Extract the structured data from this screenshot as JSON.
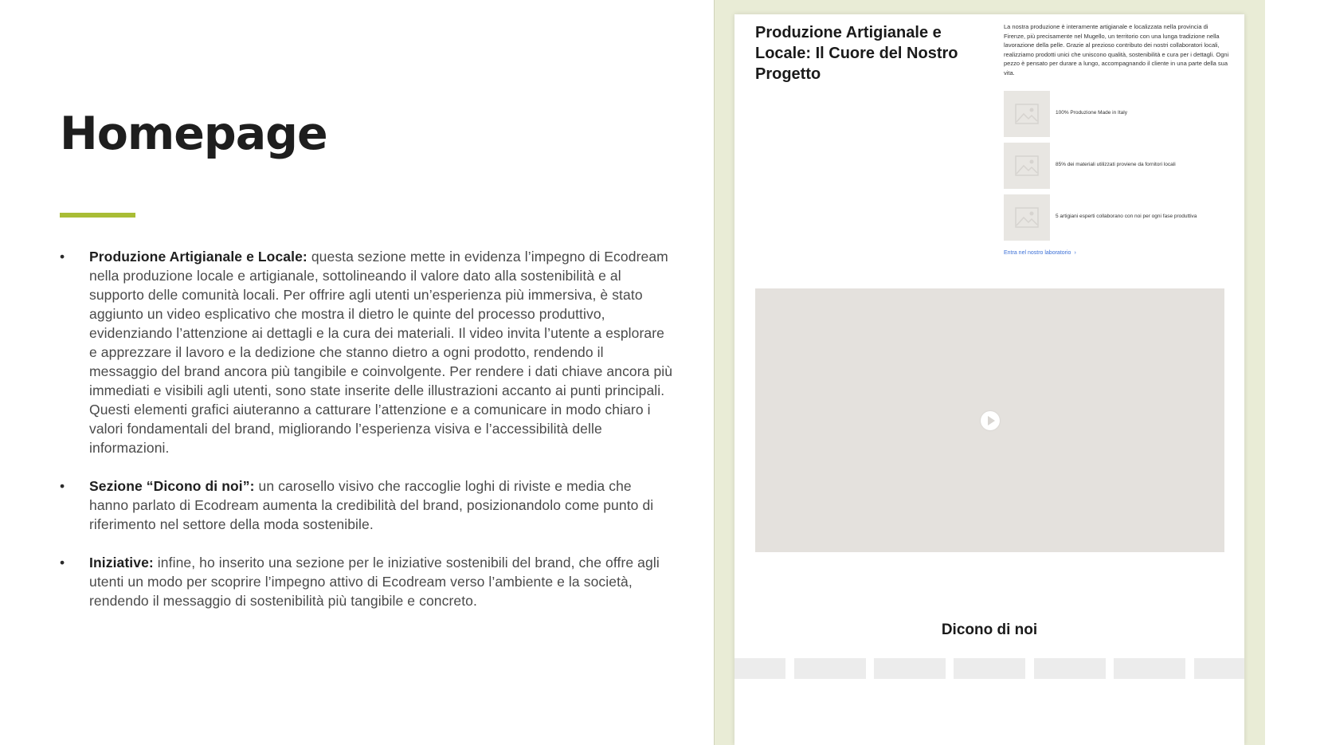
{
  "slide": {
    "title": "Homepage",
    "accent_color": "#a9bd35",
    "bullets": [
      {
        "symbol": "•",
        "heading": "Produzione Artigianale e Locale:",
        "text": " questa sezione mette in evidenza l’impegno di Ecodream nella produzione locale e artigianale, sottolineando il valore dato alla sostenibilità e al supporto delle comunità locali. Per offrire agli utenti un’esperienza più immersiva, è stato aggiunto un video esplicativo che mostra il dietro le quinte del processo produttivo, evidenziando l’attenzione ai dettagli e la cura dei materiali. Il video invita l’utente a esplorare e apprezzare il lavoro e la dedizione che stanno dietro a ogni prodotto, rendendo il messaggio del brand ancora più tangibile e coinvolgente. Per rendere i dati chiave ancora più immediati e visibili agli utenti, sono state inserite delle illustrazioni accanto ai punti principali. Questi elementi grafici aiuteranno a catturare l’attenzione e a comunicare in modo chiaro i valori fondamentali del brand, migliorando l’esperienza visiva e l’accessibilità delle informazioni."
      },
      {
        "symbol": "•",
        "heading": "Sezione “Dicono di noi”:",
        "text": " un carosello visivo che raccoglie loghi di riviste e media che hanno parlato di Ecodream aumenta la credibilità del brand, posizionandolo come punto di riferimento nel settore della moda sostenibile."
      },
      {
        "symbol": "•",
        "heading": "Iniziative:",
        "text": " infine, ho inserito una sezione per le iniziative sostenibili del brand, che offre agli utenti un modo per scoprire l’impegno attivo di Ecodream verso l’ambiente e la società, rendendo il messaggio di sostenibilità più tangibile e concreto."
      }
    ]
  },
  "mockup": {
    "frame_color": "#e9ecd6",
    "section_title": "Produzione Artigianale e Locale: Il Cuore del Nostro Progetto",
    "intro": "La nostra produzione è interamente artigianale e localizzata nella provincia di Firenze, più precisamente nel Mugello, un territorio con una lunga tradizione nella lavorazione della pelle. Grazie al prezioso contributo dei nostri collaboratori locali, realizziamo prodotti unici che uniscono qualità, sostenibilità e cura per i dettagli. Ogni pezzo è pensato per durare a lungo, accompagnando il cliente in una parte della sua vita.",
    "stats": [
      {
        "text": "100% Produzione Made in Italy",
        "icon": "image-placeholder-icon"
      },
      {
        "text": "85% dei materiali utilizzati proviene da fornitori locali",
        "icon": "image-placeholder-icon"
      },
      {
        "text": "5 artigiani esperti collaborano con noi per ogni fase produttiva",
        "icon": "image-placeholder-icon"
      }
    ],
    "lab_link": "Entra nel nostro laboratorio",
    "lab_link_icon": "chevron-right-icon",
    "video_icon": "play-icon",
    "press_title": "Dicono di noi",
    "press_logo_count": 7
  }
}
